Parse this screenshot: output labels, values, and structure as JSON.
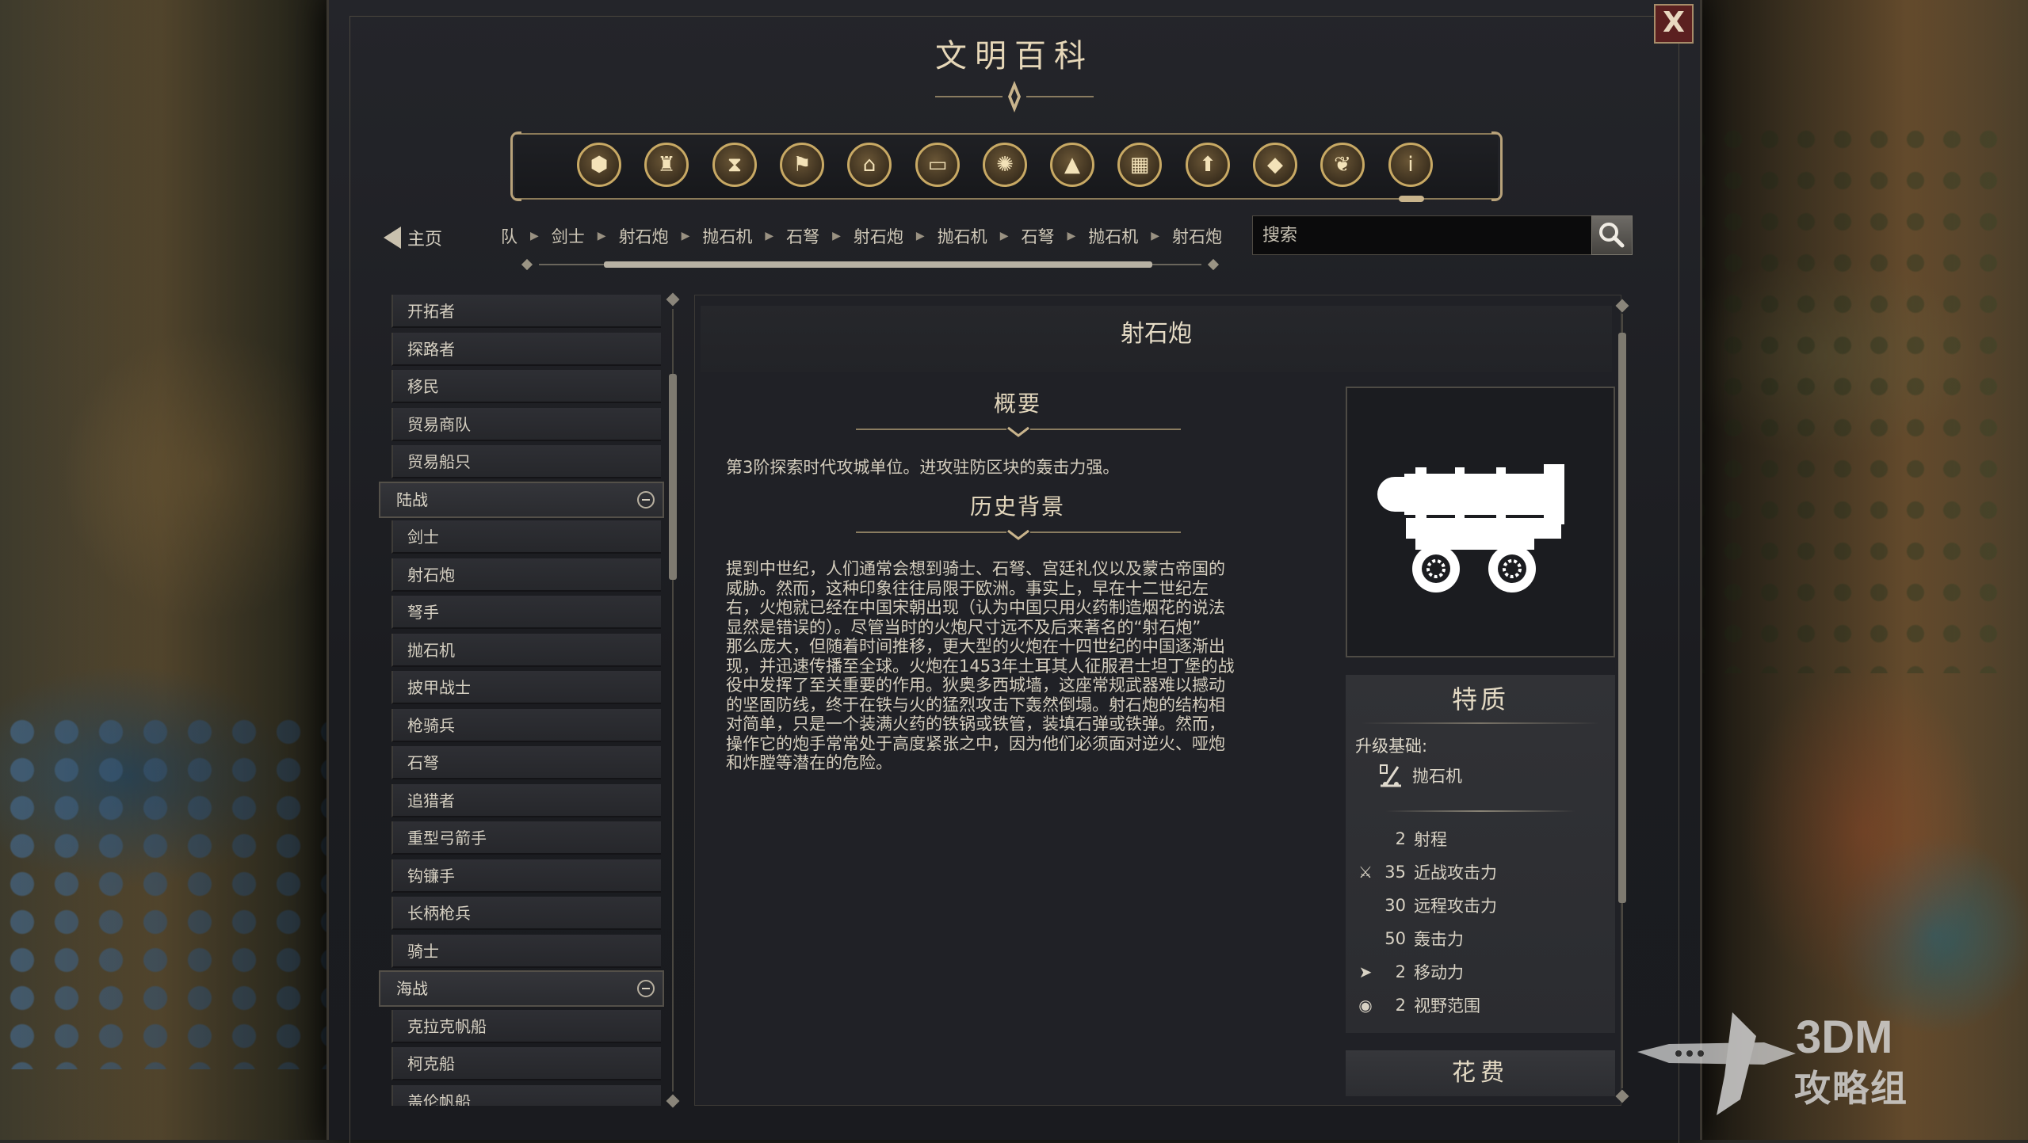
{
  "window": {
    "title": "文明百科",
    "close_label": "X"
  },
  "categories": [
    {
      "name": "units-icon",
      "glyph": "⬢"
    },
    {
      "name": "goblet-icon",
      "glyph": "♜"
    },
    {
      "name": "hourglass-icon",
      "glyph": "⧗"
    },
    {
      "name": "flag-icon",
      "glyph": "⚑"
    },
    {
      "name": "temple-icon",
      "glyph": "⌂"
    },
    {
      "name": "book-icon",
      "glyph": "▭"
    },
    {
      "name": "atom-icon",
      "glyph": "✺"
    },
    {
      "name": "mountain-icon",
      "glyph": "▲"
    },
    {
      "name": "building-icon",
      "glyph": "▦"
    },
    {
      "name": "upgrade-icon",
      "glyph": "⬆"
    },
    {
      "name": "resource-icon",
      "glyph": "◆"
    },
    {
      "name": "dove-icon",
      "glyph": "❦"
    },
    {
      "name": "info-icon",
      "glyph": "i"
    }
  ],
  "nav": {
    "home_label": "主页",
    "breadcrumbs": [
      "队",
      "剑士",
      "射石炮",
      "抛石机",
      "石弩",
      "射石炮",
      "抛石机",
      "石弩",
      "抛石机",
      "射石炮"
    ],
    "search_placeholder": "搜索"
  },
  "list": {
    "items_top": [
      "开拓者",
      "探路者",
      "移民",
      "贸易商队",
      "贸易船只"
    ],
    "group_land": "陆战",
    "items_land": [
      "剑士",
      "射石炮",
      "弩手",
      "抛石机",
      "披甲战士",
      "枪骑兵",
      "石弩",
      "追猎者",
      "重型弓箭手",
      "钩镰手",
      "长柄枪兵",
      "骑士"
    ],
    "group_naval": "海战",
    "items_naval": [
      "克拉克帆船",
      "柯克船",
      "盖伦帆船"
    ]
  },
  "article": {
    "title": "射石炮",
    "overview_heading": "概要",
    "overview_text": "第3阶探索时代攻城单位。进攻驻防区块的轰击力强。",
    "history_heading": "历史背景",
    "history_lines": [
      "提到中世纪，人们通常会想到骑士、石弩、宫廷礼仪以及蒙古帝国的",
      "威胁。然而，这种印象往往局限于欧洲。事实上，早在十二世纪左",
      "右，火炮就已经在中国宋朝出现（认为中国只用火药制造烟花的说法",
      "显然是错误的）。尽管当时的火炮尺寸远不及后来著名的“射石炮”",
      "那么庞大，但随着时间推移，更大型的火炮在十四世纪的中国逐渐出",
      "现，并迅速传播至全球。火炮在1453年土耳其人征服君士坦丁堡的战",
      "役中发挥了至关重要的作用。狄奥多西城墙，这座常规武器难以撼动",
      "的坚固防线，终于在铁与火的猛烈攻击下轰然倒塌。射石炮的结构相",
      "对简单，只是一个装满火药的铁锅或铁管，装填石弹或铁弹。然而，",
      "操作它的炮手常常处于高度紧张之中，因为他们必须面对逆火、哑炮",
      "和炸膛等潜在的危险。"
    ]
  },
  "traits": {
    "heading": "特质",
    "upgrade_label": "升级基础:",
    "upgrade_unit": "抛石机",
    "stats": [
      {
        "icon": "",
        "icon_name": "range-stat",
        "value": "2",
        "label": "射程"
      },
      {
        "icon": "⚔",
        "icon_name": "sword-icon",
        "value": "35",
        "label": "近战攻击力"
      },
      {
        "icon": "",
        "icon_name": "ranged-stat",
        "value": "30",
        "label": "远程攻击力"
      },
      {
        "icon": "",
        "icon_name": "bombard-stat",
        "value": "50",
        "label": "轰击力"
      },
      {
        "icon": "➤",
        "icon_name": "movement-icon",
        "value": "2",
        "label": "移动力"
      },
      {
        "icon": "◉",
        "icon_name": "eye-icon",
        "value": "2",
        "label": "视野范围"
      }
    ]
  },
  "cost": {
    "heading": "花费"
  },
  "watermark": {
    "line1": "3DM",
    "line2": "攻略组"
  },
  "colors": {
    "gold": "#c8a964",
    "close_bg": "#5b2020",
    "panel_bg": "#202126"
  }
}
